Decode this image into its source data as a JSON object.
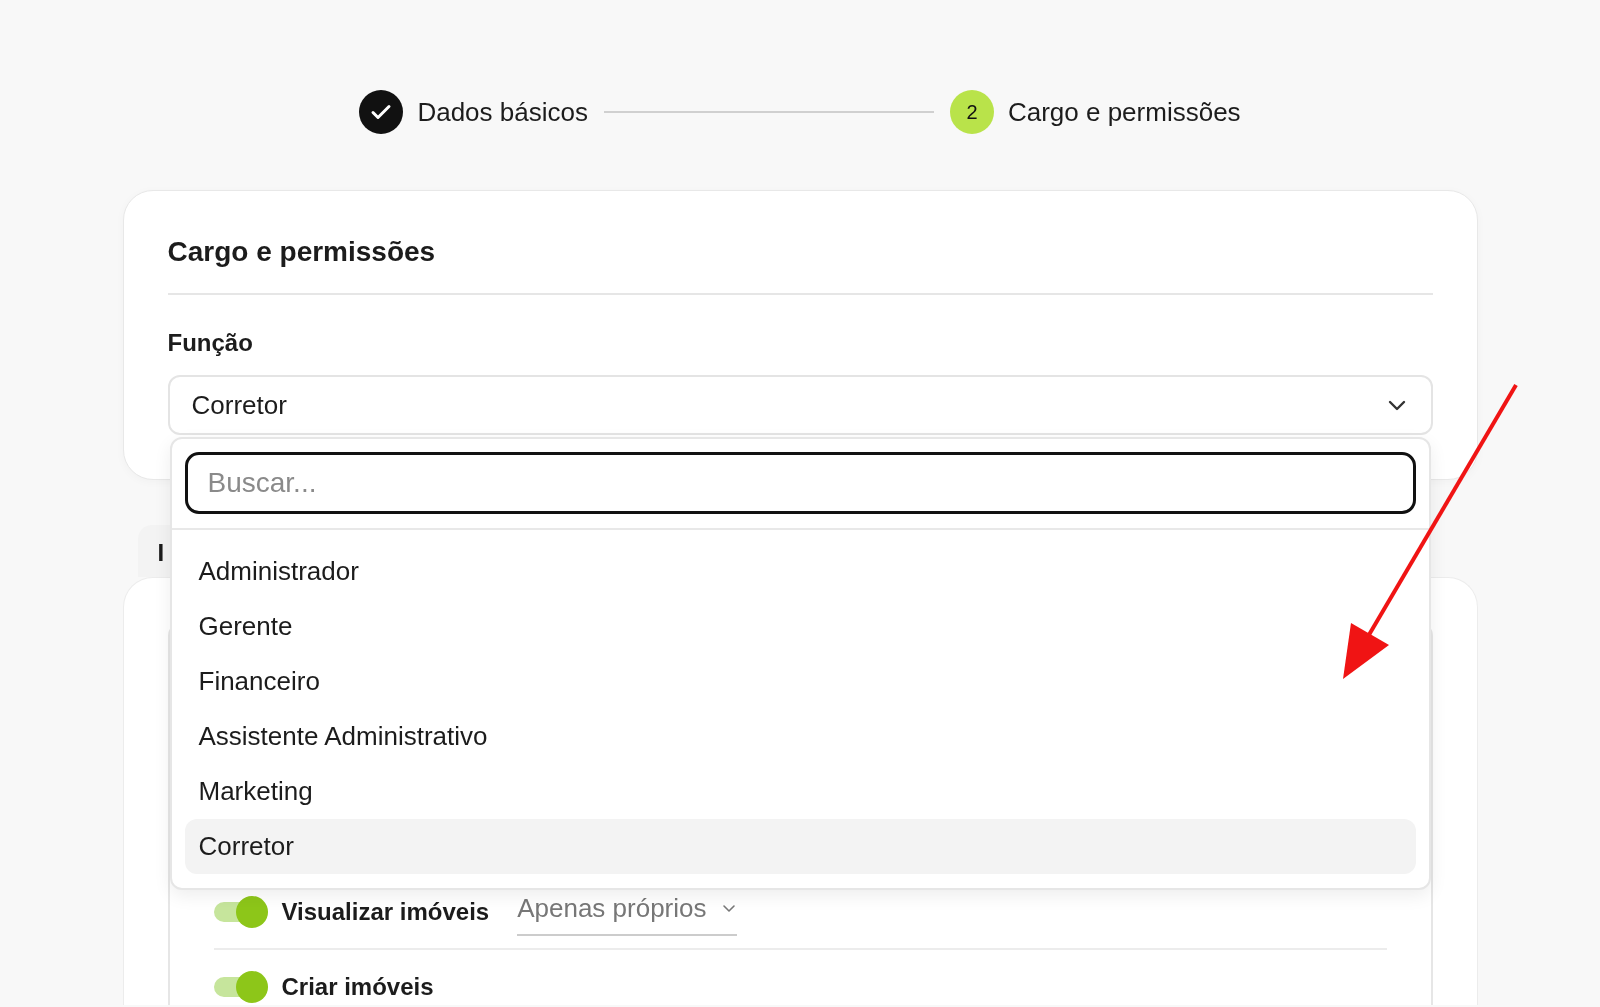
{
  "stepper": {
    "steps": [
      {
        "label": "Dados básicos",
        "completed": true
      },
      {
        "number": "2",
        "label": "Cargo e permissões",
        "completed": false,
        "current": true
      }
    ]
  },
  "role_card": {
    "title": "Cargo e permissões",
    "field_label": "Função",
    "select_value": "Corretor",
    "dropdown": {
      "search_placeholder": "Buscar...",
      "options": [
        {
          "label": "Administrador",
          "selected": false
        },
        {
          "label": "Gerente",
          "selected": false
        },
        {
          "label": "Financeiro",
          "selected": false
        },
        {
          "label": "Assistente Administrativo",
          "selected": false
        },
        {
          "label": "Marketing",
          "selected": false
        },
        {
          "label": "Corretor",
          "selected": true
        }
      ]
    }
  },
  "permissions_card": {
    "tab_fragment": "I",
    "rows": [
      {
        "label": "Visualizar imóveis",
        "on": true,
        "scope": "Apenas próprios"
      },
      {
        "label": "Criar imóveis",
        "on": true
      }
    ]
  }
}
